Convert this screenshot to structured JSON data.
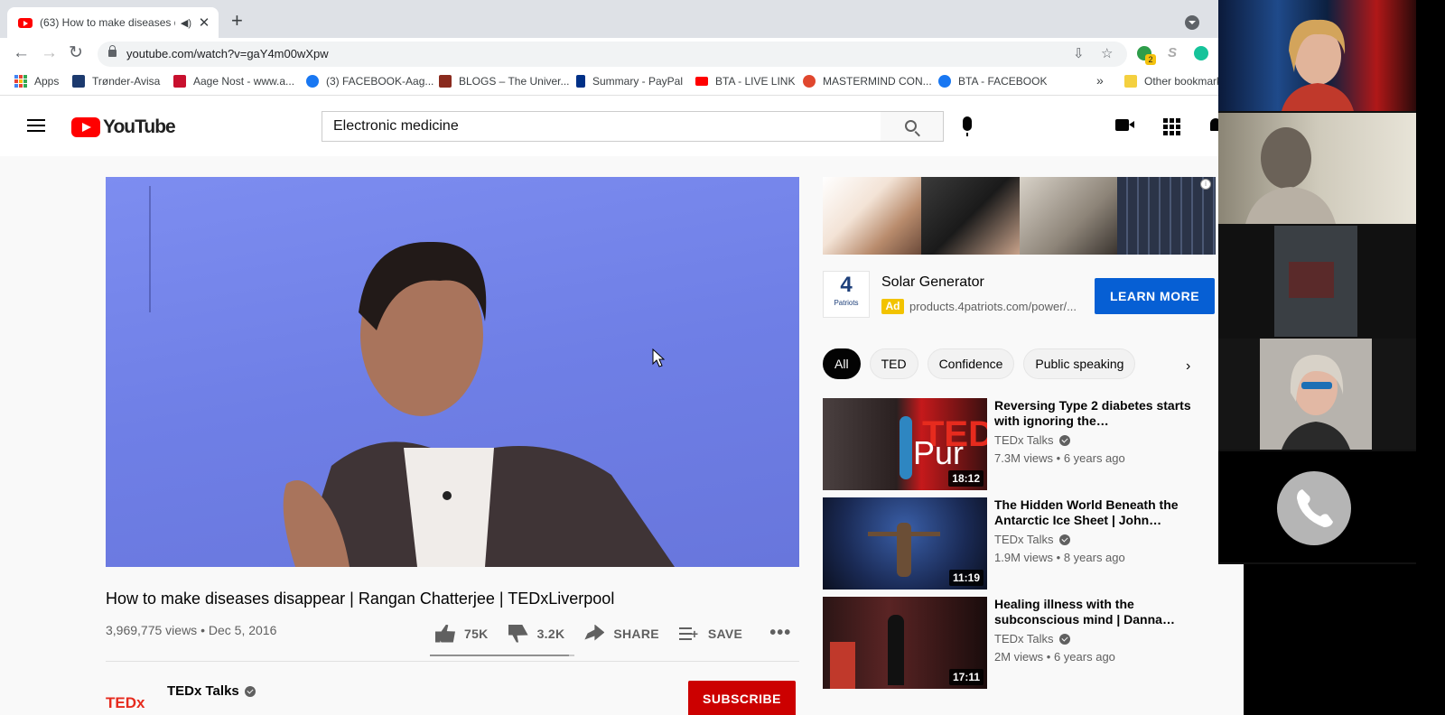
{
  "browser": {
    "tab_title": "(63) How to make diseases d",
    "new_tab": "+",
    "url": "youtube.com/watch?v=gaY4m00wXpw",
    "extension_badge": "2"
  },
  "bookmarks": {
    "items": [
      "Apps",
      "Trønder-Avisa",
      "Aage Nost - www.a...",
      "(3) FACEBOOK-Aag...",
      "BLOGS – The Univer...",
      "Summary - PayPal",
      "BTA - LIVE LINK",
      "MASTERMIND CON...",
      "BTA - FACEBOOK"
    ],
    "overflow": "»",
    "other": "Other bookmarks"
  },
  "youtube": {
    "logo": "YouTube",
    "search_value": "Electronic medicine"
  },
  "video": {
    "title": "How to make diseases disappear | Rangan Chatterjee | TEDxLiverpool",
    "views": "3,969,775 views",
    "date": "Dec 5, 2016",
    "likes": "75K",
    "dislikes": "3.2K",
    "share": "SHARE",
    "save": "SAVE",
    "more": "•••",
    "like_ratio": 0.96,
    "channel": "TEDx Talks",
    "channel_logo": "TEDx",
    "subscribe": "SUBSCRIBE"
  },
  "ad": {
    "title": "Solar Generator",
    "badge": "Ad",
    "url": "products.4patriots.com/power/...",
    "cta": "LEARN MORE",
    "logo_mark": "4",
    "logo_text": "Patriots"
  },
  "chips": [
    "All",
    "TED",
    "Confidence",
    "Public speaking"
  ],
  "recommendations": [
    {
      "title": "Reversing Type 2 diabetes starts with ignoring the…",
      "channel": "TEDx Talks",
      "views": "7.3M views",
      "age": "6 years ago",
      "duration": "18:12"
    },
    {
      "title": "The Hidden World Beneath the Antarctic Ice Sheet | John…",
      "channel": "TEDx Talks",
      "views": "1.9M views",
      "age": "8 years ago",
      "duration": "11:19"
    },
    {
      "title": "Healing illness with the subconscious mind | Danna…",
      "channel": "TEDx Talks",
      "views": "2M views",
      "age": "6 years ago",
      "duration": "17:11"
    }
  ],
  "colors": {
    "youtube_red": "#ff0000",
    "subscribe": "#cc0000",
    "learn_more": "#065fd4",
    "player_bg": "#7686ea",
    "ad_badge": "#f2c300"
  }
}
